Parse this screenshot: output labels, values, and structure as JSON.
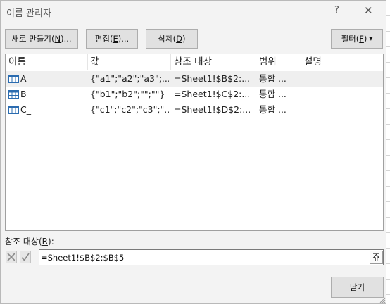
{
  "window": {
    "title": "이름 관리자",
    "help": "?",
    "close_glyph": "✕"
  },
  "toolbar": {
    "new_label": "새로 만들기(",
    "new_key": "N",
    "new_suffix": ")...",
    "edit_label": "편집(",
    "edit_key": "E",
    "edit_suffix": ")...",
    "delete_label": "삭제(",
    "delete_key": "D",
    "delete_suffix": ")",
    "filter_label": "필터(",
    "filter_key": "F",
    "filter_suffix": ")",
    "filter_arrow": "▾"
  },
  "list": {
    "columns": [
      "이름",
      "값",
      "참조 대상",
      "범위",
      "설명"
    ],
    "rows": [
      {
        "name": "A",
        "value": "{\"a1\";\"a2\";\"a3\";...",
        "refers_to": "=Sheet1!$B$2:...",
        "scope": "통합 ...",
        "comment": ""
      },
      {
        "name": "B",
        "value": "{\"b1\";\"b2\";\"\";\"\"}",
        "refers_to": "=Sheet1!$C$2:...",
        "scope": "통합 ...",
        "comment": ""
      },
      {
        "name": "C_",
        "value": "{\"c1\";\"c2\";\"c3\";\"...",
        "refers_to": "=Sheet1!$D$2:...",
        "scope": "통합 ...",
        "comment": ""
      }
    ]
  },
  "refers": {
    "label_prefix": "참조 대상(",
    "label_key": "R",
    "label_suffix": "):",
    "value": "=Sheet1!$B$2:$B$5"
  },
  "footer": {
    "close_label": "닫기"
  },
  "colors": {
    "accent_icon": "#2b6cb0",
    "selected_row": "#efefef",
    "cancel_x": "#8a8a8a",
    "confirm_check": "#8a8a8a"
  }
}
